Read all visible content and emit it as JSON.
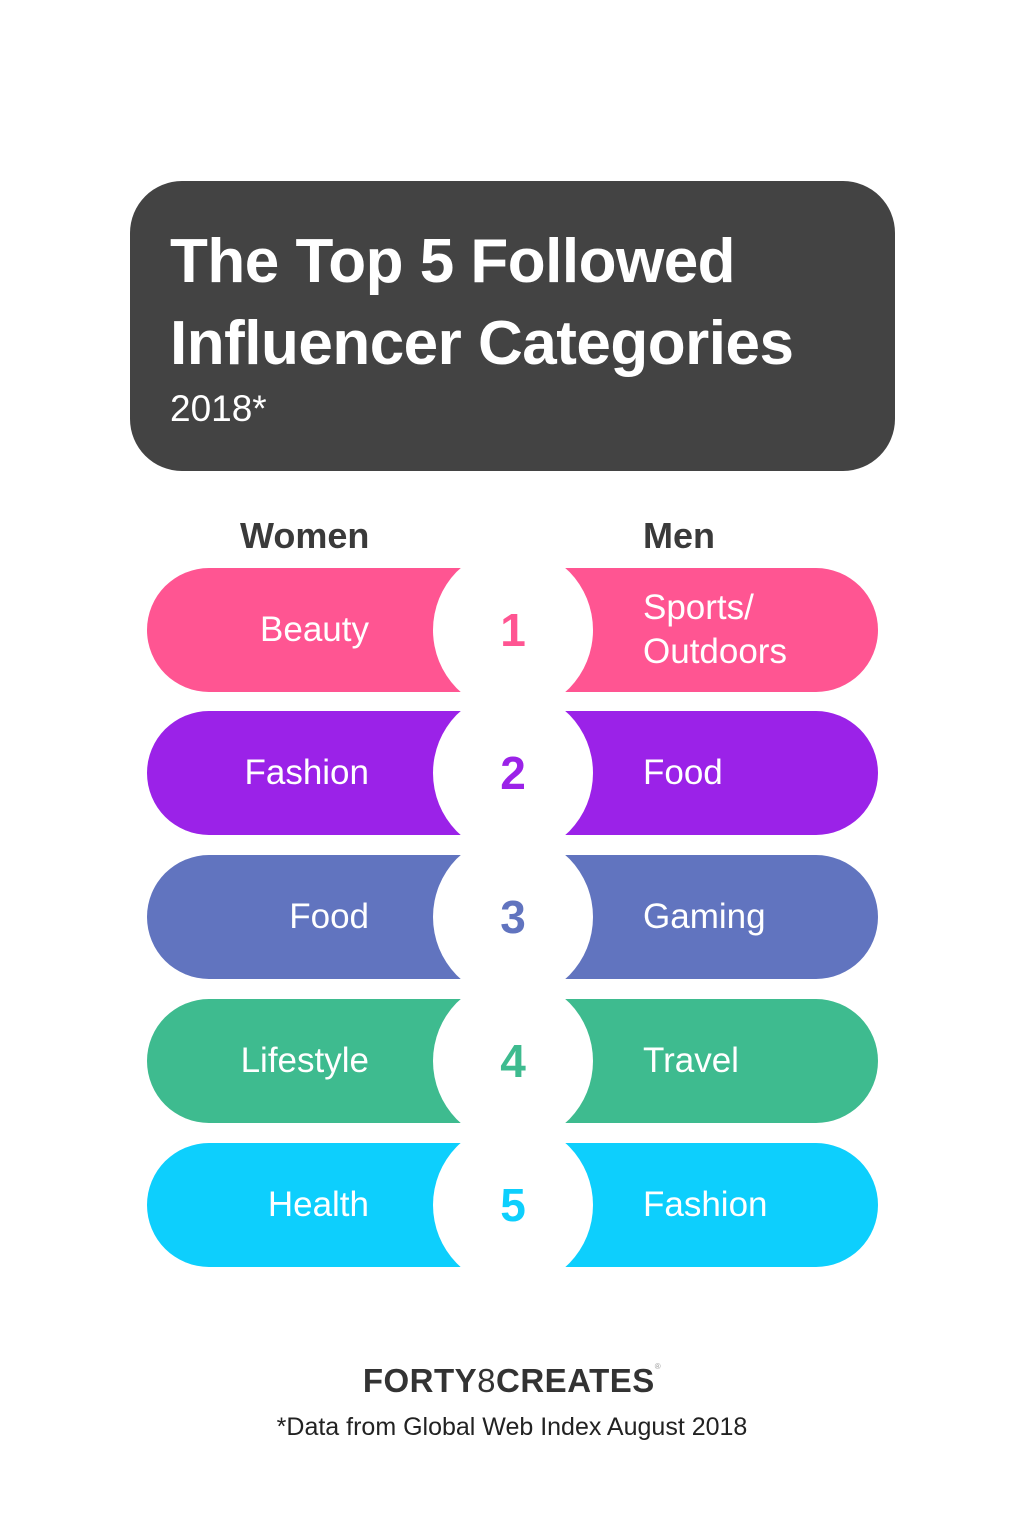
{
  "header": {
    "title_line1": "The Top 5 Followed",
    "title_line2": "Influencer Categories",
    "year": "2018*",
    "background_color": "#434343"
  },
  "columns": {
    "women": "Women",
    "men": "Men"
  },
  "rows": [
    {
      "rank": "1",
      "women": "Beauty",
      "men_line1": "Sports/",
      "men_line2": "Outdoors",
      "color": "#FF5592"
    },
    {
      "rank": "2",
      "women": "Fashion",
      "men_line1": "Food",
      "men_line2": "",
      "color": "#9B22E8"
    },
    {
      "rank": "3",
      "women": "Food",
      "men_line1": "Gaming",
      "men_line2": "",
      "color": "#6174BF"
    },
    {
      "rank": "4",
      "women": "Lifestyle",
      "men_line1": "Travel",
      "men_line2": "",
      "color": "#3EBB8F"
    },
    {
      "rank": "5",
      "women": "Health",
      "men_line1": "Fashion",
      "men_line2": "",
      "color": "#0DCFFD"
    }
  ],
  "footer": {
    "logo_part1": "FORTY",
    "logo_part2": "8",
    "logo_part3": "CREATES",
    "logo_reg": "®",
    "footnote": "*Data from Global Web Index August 2018"
  }
}
